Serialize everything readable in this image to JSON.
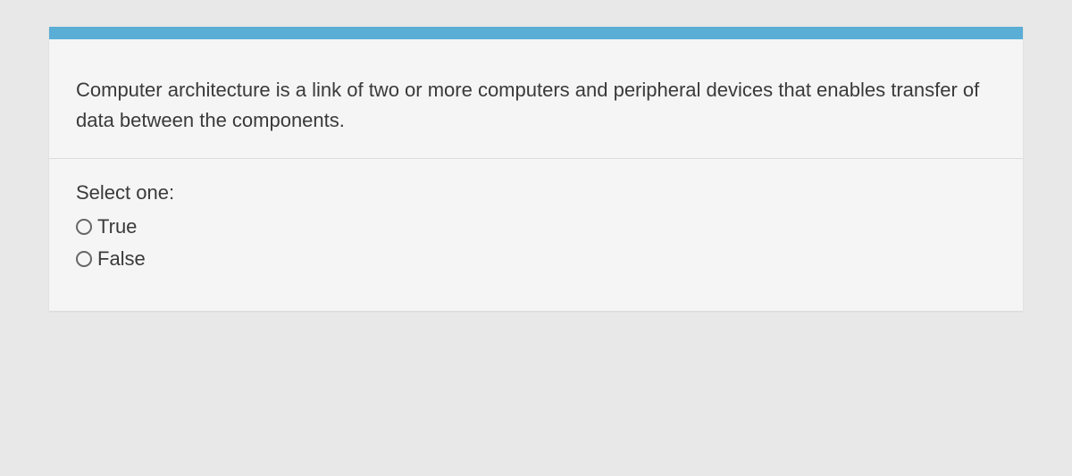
{
  "question": {
    "text": "Computer architecture is a link of two or more computers and peripheral devices that enables transfer of data between the components.",
    "select_prompt": "Select one:",
    "options": [
      {
        "label": "True",
        "value": "true"
      },
      {
        "label": "False",
        "value": "false"
      }
    ]
  }
}
